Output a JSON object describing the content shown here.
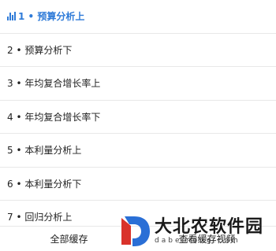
{
  "list": {
    "items": [
      {
        "label": "1 • 预算分析上",
        "active": true
      },
      {
        "label": "2 • 预算分析下",
        "active": false
      },
      {
        "label": "3 • 年均复合增长率上",
        "active": false
      },
      {
        "label": "4 • 年均复合增长率下",
        "active": false
      },
      {
        "label": "5 • 本利量分析上",
        "active": false
      },
      {
        "label": "6 • 本利量分析下",
        "active": false
      },
      {
        "label": "7 • 回归分析上",
        "active": false
      }
    ]
  },
  "bottom_bar": {
    "cache_all_label": "全部缓存",
    "view_cache_label": "查看缓存视频"
  },
  "watermark": {
    "title": "大北农软件园",
    "subtitle": "dabeinong.com",
    "colors": {
      "logo_red": "#d9322b",
      "logo_blue": "#2a6fd6"
    }
  },
  "colors": {
    "accent": "#2f7bd8",
    "text": "#222222",
    "divider": "#e8e8e8"
  }
}
